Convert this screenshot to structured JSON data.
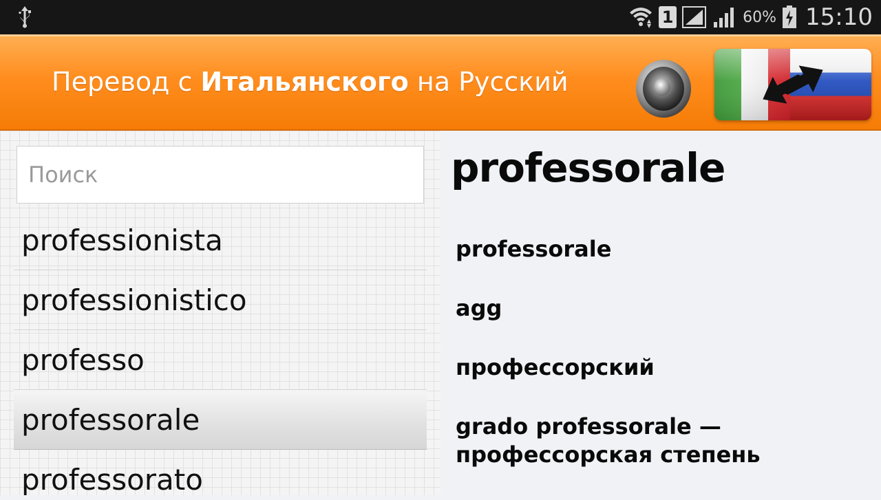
{
  "status_bar": {
    "signal_sim_label": "1",
    "battery_percent": "60%",
    "clock": "15:10",
    "icons": [
      "usb-icon",
      "wifi-icon",
      "sim-icon",
      "signal-icon",
      "battery-charging-icon"
    ]
  },
  "header": {
    "title_prefix": "Перевод с ",
    "title_from": "Итальянского",
    "title_mid": " на ",
    "title_to": "Русский",
    "speaker_icon": "speaker-icon",
    "switch_icon": "flag-switch-icon",
    "accent_color": "#ff8d1e"
  },
  "search": {
    "placeholder": "Поиск",
    "value": ""
  },
  "word_list": [
    {
      "label": "professionista",
      "selected": false
    },
    {
      "label": "professionistico",
      "selected": false
    },
    {
      "label": "professo",
      "selected": false
    },
    {
      "label": "professorale",
      "selected": true
    },
    {
      "label": "professorato",
      "selected": false
    }
  ],
  "entry": {
    "headword": "professorale",
    "lines": [
      "professorale",
      "agg",
      "профессорский",
      "grado professorale — профессорская степень"
    ]
  }
}
